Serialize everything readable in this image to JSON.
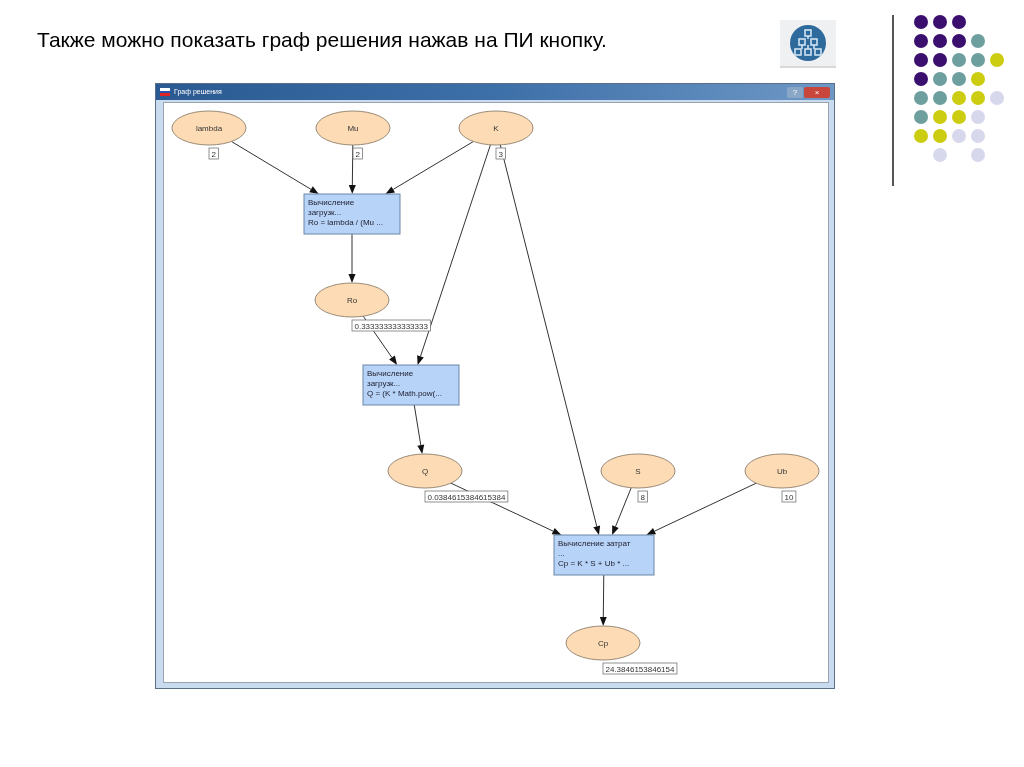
{
  "slide": {
    "heading": "Также можно показать граф решения нажав на ПИ кнопку."
  },
  "window": {
    "title": "Граф решения",
    "buttons": [
      "?",
      "×"
    ]
  },
  "graph": {
    "nodes": [
      {
        "kind": "variable",
        "label": "lambda",
        "value": "2"
      },
      {
        "kind": "variable",
        "label": "Mu",
        "value": "2"
      },
      {
        "kind": "variable",
        "label": "K",
        "value": "3"
      },
      {
        "kind": "calculation",
        "lines": [
          "Вычисление",
          "загрузк...",
          "Ro = lambda / (Mu ..."
        ]
      },
      {
        "kind": "variable",
        "label": "Ro",
        "value": "0.333333333333333"
      },
      {
        "kind": "calculation",
        "lines": [
          "Вычисление",
          "загрузк...",
          "Q = (K * Math.pow(..."
        ]
      },
      {
        "kind": "variable",
        "label": "Q",
        "value": "0.0384615384615384"
      },
      {
        "kind": "variable",
        "label": "S",
        "value": "8"
      },
      {
        "kind": "variable",
        "label": "Ub",
        "value": "10"
      },
      {
        "kind": "calculation",
        "lines": [
          "Вычисление затрат",
          "...",
          "Cp = K * S + Ub * ..."
        ]
      },
      {
        "kind": "variable",
        "label": "Cp",
        "value": "24.3846153846154"
      }
    ]
  }
}
